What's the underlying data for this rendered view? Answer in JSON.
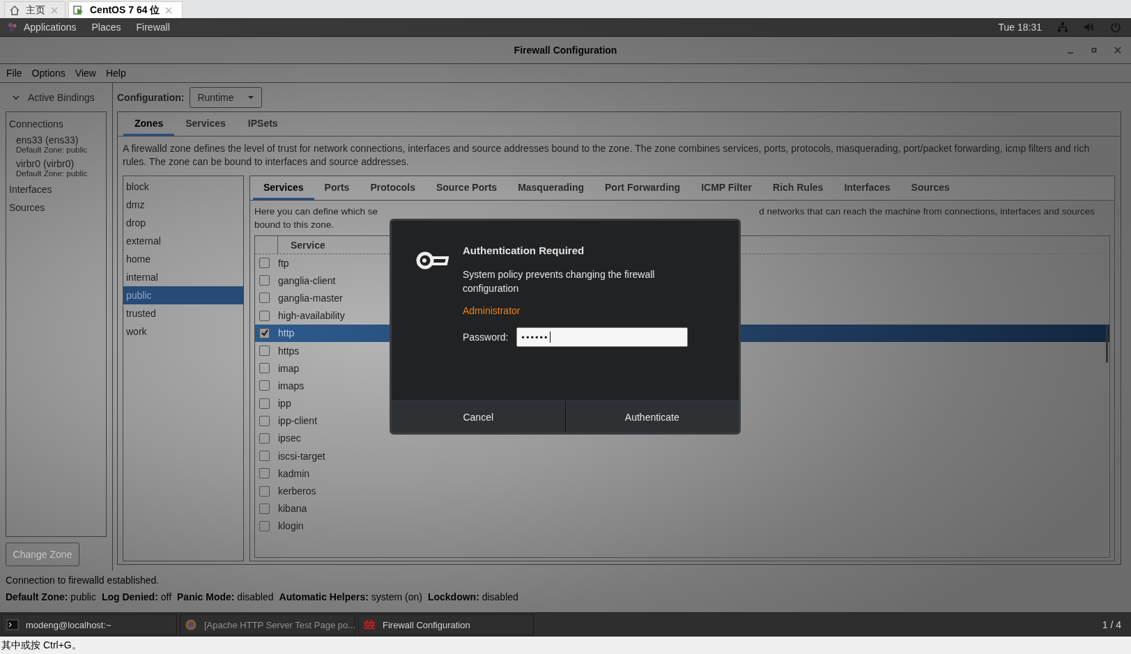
{
  "vm_tabs": [
    {
      "label": "主页",
      "kind": "home",
      "selected": false
    },
    {
      "label": "CentOS 7 64 位",
      "kind": "vm",
      "selected": true
    }
  ],
  "top_bar": {
    "menus": [
      "Applications",
      "Places",
      "Firewall"
    ],
    "clock": "Tue 18:31"
  },
  "window": {
    "title": "Firewall Configuration"
  },
  "menu_bar": [
    "File",
    "Options",
    "View",
    "Help"
  ],
  "sidebar": {
    "header": "Active Bindings",
    "expanded": true,
    "sections": [
      {
        "label": "Connections",
        "items": [
          {
            "name": "ens33 (ens33)",
            "detail": "Default Zone: public"
          },
          {
            "name": "virbr0 (virbr0)",
            "detail": "Default Zone: public"
          }
        ]
      },
      {
        "label": "Interfaces"
      },
      {
        "label": "Sources"
      }
    ],
    "button": {
      "label": "Change Zone",
      "disabled": true
    }
  },
  "configuration": {
    "label": "Configuration:",
    "value": "Runtime"
  },
  "main_tabs": [
    {
      "label": "Zones",
      "selected": true
    },
    {
      "label": "Services",
      "selected": false
    },
    {
      "label": "IPSets",
      "selected": false
    }
  ],
  "zone_description": "A firewalld zone defines the level of trust for network connections, interfaces and source addresses bound to the zone. The zone combines services, ports, protocols, masquerading, port/packet forwarding, icmp filters and rich rules. The zone can be bound to interfaces and source addresses.",
  "zones": [
    {
      "name": "block",
      "selected": false
    },
    {
      "name": "dmz",
      "selected": false
    },
    {
      "name": "drop",
      "selected": false
    },
    {
      "name": "external",
      "selected": false
    },
    {
      "name": "home",
      "selected": false
    },
    {
      "name": "internal",
      "selected": false
    },
    {
      "name": "public",
      "selected": true
    },
    {
      "name": "trusted",
      "selected": false
    },
    {
      "name": "work",
      "selected": false
    }
  ],
  "zone_tabs": [
    {
      "label": "Services",
      "selected": true
    },
    {
      "label": "Ports",
      "selected": false
    },
    {
      "label": "Protocols",
      "selected": false
    },
    {
      "label": "Source Ports",
      "selected": false
    },
    {
      "label": "Masquerading",
      "selected": false
    },
    {
      "label": "Port Forwarding",
      "selected": false
    },
    {
      "label": "ICMP Filter",
      "selected": false
    },
    {
      "label": "Rich Rules",
      "selected": false
    },
    {
      "label": "Interfaces",
      "selected": false
    },
    {
      "label": "Sources",
      "selected": false
    }
  ],
  "services_description": {
    "left_part": "Here you can define which se",
    "right_part": "d networks that can reach the machine from connections, interfaces and sources",
    "second_line": "bound to this zone."
  },
  "services_table": {
    "column": "Service",
    "rows": [
      {
        "name": "ftp",
        "checked": false,
        "selected": false
      },
      {
        "name": "ganglia-client",
        "checked": false,
        "selected": false
      },
      {
        "name": "ganglia-master",
        "checked": false,
        "selected": false
      },
      {
        "name": "high-availability",
        "checked": false,
        "selected": false
      },
      {
        "name": "http",
        "checked": true,
        "selected": true
      },
      {
        "name": "https",
        "checked": false,
        "selected": false
      },
      {
        "name": "imap",
        "checked": false,
        "selected": false
      },
      {
        "name": "imaps",
        "checked": false,
        "selected": false
      },
      {
        "name": "ipp",
        "checked": false,
        "selected": false
      },
      {
        "name": "ipp-client",
        "checked": false,
        "selected": false
      },
      {
        "name": "ipsec",
        "checked": false,
        "selected": false
      },
      {
        "name": "iscsi-target",
        "checked": false,
        "selected": false
      },
      {
        "name": "kadmin",
        "checked": false,
        "selected": false
      },
      {
        "name": "kerberos",
        "checked": false,
        "selected": false
      },
      {
        "name": "kibana",
        "checked": false,
        "selected": false
      },
      {
        "name": "klogin",
        "checked": false,
        "selected": false
      }
    ]
  },
  "status": {
    "message": "Connection to firewalld established.",
    "fields": [
      {
        "label": "Default Zone:",
        "value": "public"
      },
      {
        "label": "Log Denied:",
        "value": "off"
      },
      {
        "label": "Panic Mode:",
        "value": "disabled"
      },
      {
        "label": "Automatic Helpers:",
        "value": "system (on)"
      },
      {
        "label": "Lockdown:",
        "value": "disabled"
      }
    ]
  },
  "taskbar": {
    "items": [
      {
        "label": "modeng@localhost:~",
        "kind": "terminal",
        "minimized": false
      },
      {
        "label": "[Apache HTTP Server Test Page po...",
        "kind": "browser",
        "minimized": true
      },
      {
        "label": "Firewall Configuration",
        "kind": "firewall",
        "minimized": false
      }
    ],
    "pager": "1 / 4"
  },
  "hint_bar": "其中或按 Ctrl+G。",
  "dialog": {
    "title": "Authentication Required",
    "message": "System policy prevents changing the firewall configuration",
    "user": "Administrator",
    "password_label": "Password:",
    "password_value": "••••••",
    "buttons": [
      "Cancel",
      "Authenticate"
    ]
  }
}
